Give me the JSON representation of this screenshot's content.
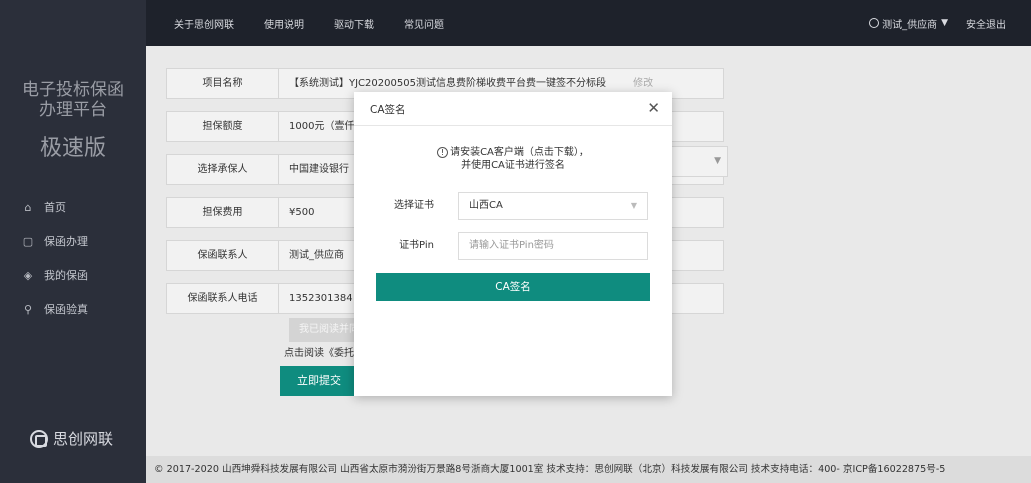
{
  "sidebar": {
    "title_line1": "电子投标保函",
    "title_line2": "办理平台",
    "subtitle": "极速版",
    "items": [
      {
        "icon": "home-icon",
        "glyph": "⌂",
        "label": "首页"
      },
      {
        "icon": "document-icon",
        "glyph": "▢",
        "label": "保函办理"
      },
      {
        "icon": "layers-icon",
        "glyph": "◈",
        "label": "我的保函"
      },
      {
        "icon": "search-icon",
        "glyph": "⚲",
        "label": "保函验真"
      }
    ],
    "logo_text": "思创网联"
  },
  "topbar": {
    "nav": [
      "关于思创网联",
      "使用说明",
      "驱动下载",
      "常见问题"
    ],
    "user": "测试_供应商",
    "logout": "安全退出"
  },
  "form": {
    "rows": [
      {
        "label": "项目名称",
        "value": "【系统测试】YJC20200505测试信息费阶梯收费平台费一键签不分标段",
        "extra": "修改"
      },
      {
        "label": "担保额度",
        "value": "1000元（壹仟"
      },
      {
        "label": "选择承保人",
        "value": "中国建设银行"
      },
      {
        "label": "担保费用",
        "value": "¥500"
      },
      {
        "label": "保函联系人",
        "value": "测试_供应商"
      },
      {
        "label": "保函联系人电话",
        "value": "1352301384"
      }
    ],
    "agree_button": "我已阅读并同",
    "read_text": "点击阅读《委托",
    "submit_button": "立即提交"
  },
  "footer": {
    "text": "© 2017-2020  山西坤舜科技发展有限公司 山西省太原市漪汾街万景路8号浙商大厦1001室   技术支持：思创网联（北京）科技发展有限公司   技术支持电话：400-  京ICP备16022875号-5"
  },
  "modal": {
    "title": "CA签名",
    "close": "✕",
    "notice_line1": "请安装CA客户端（点击下载），",
    "notice_line2": "并使用CA证书进行签名",
    "cert_label": "选择证书",
    "cert_value": "山西CA",
    "pin_label": "证书Pin",
    "pin_placeholder": "请输入证书Pin密码",
    "sign_button": "CA签名"
  }
}
